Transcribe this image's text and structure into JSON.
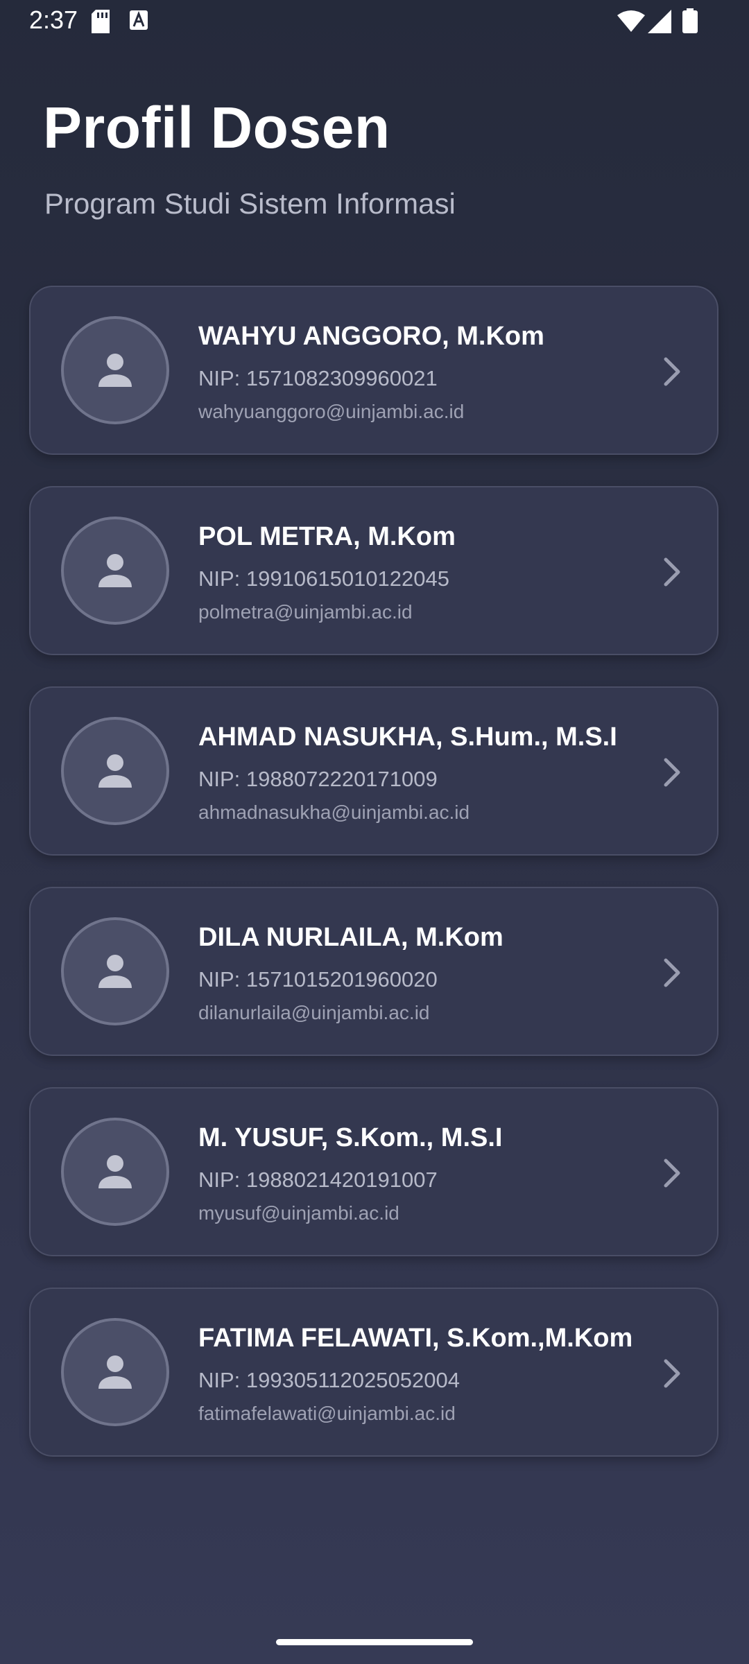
{
  "status_bar": {
    "time": "2:37"
  },
  "header": {
    "title": "Profil Dosen",
    "subtitle": "Program Studi Sistem Informasi"
  },
  "lecturers": [
    {
      "name": "WAHYU ANGGORO, M.Kom",
      "nip": "NIP: 1571082309960021",
      "email": "wahyuanggoro@uinjambi.ac.id"
    },
    {
      "name": "POL METRA, M.Kom",
      "nip": "NIP: 19910615010122045",
      "email": "polmetra@uinjambi.ac.id"
    },
    {
      "name": "AHMAD NASUKHA, S.Hum., M.S.I",
      "nip": "NIP: 1988072220171009",
      "email": "ahmadnasukha@uinjambi.ac.id"
    },
    {
      "name": "DILA NURLAILA, M.Kom",
      "nip": "NIP: 1571015201960020",
      "email": "dilanurlaila@uinjambi.ac.id"
    },
    {
      "name": "M. YUSUF, S.Kom., M.S.I",
      "nip": "NIP: 1988021420191007",
      "email": "myusuf@uinjambi.ac.id"
    },
    {
      "name": "FATIMA FELAWATI, S.Kom.,M.Kom",
      "nip": "NIP: 199305112025052004",
      "email": "fatimafelawati@uinjambi.ac.id"
    }
  ],
  "icons": {
    "avatar": "person-icon",
    "card_action": "chevron-right-icon"
  },
  "colors": {
    "background": "#2d3146",
    "card": "#343850",
    "text_primary": "#ffffff",
    "text_secondary": "#b7bac9"
  }
}
